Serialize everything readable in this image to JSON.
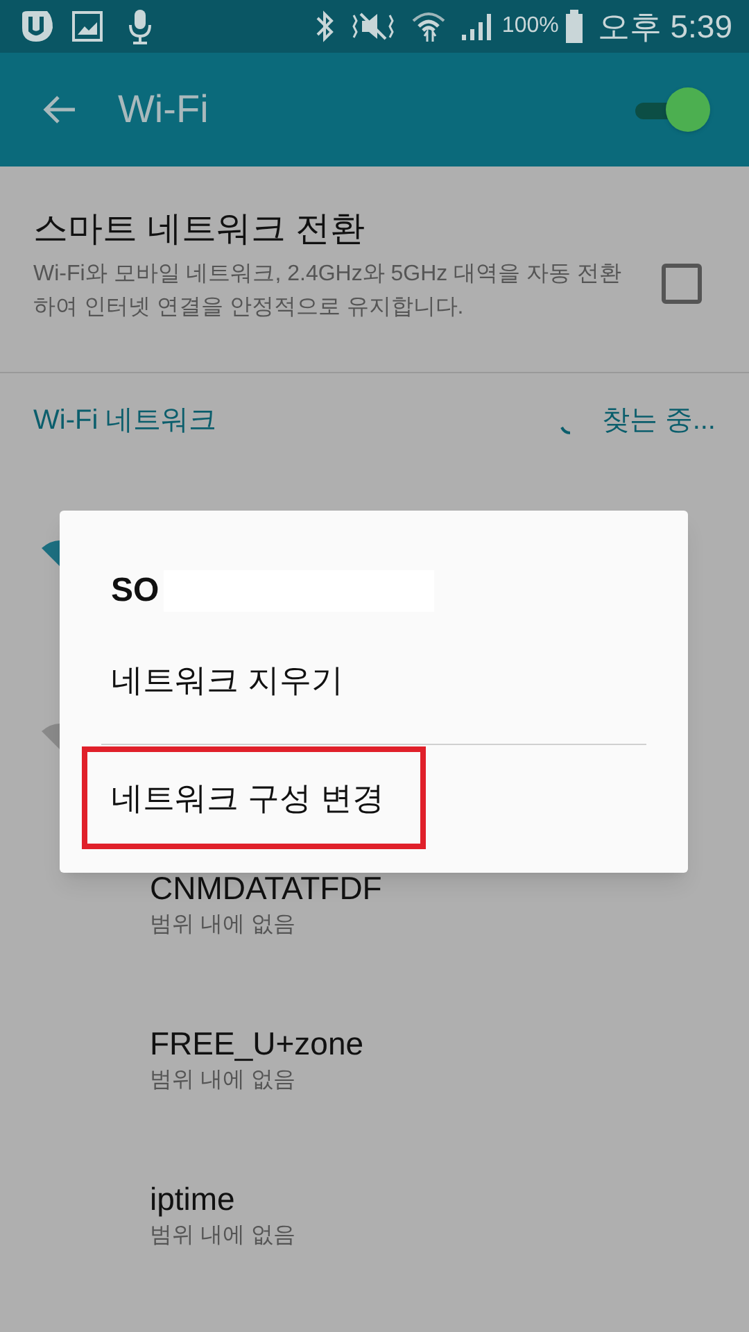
{
  "status_bar": {
    "battery": "100%",
    "time": "오후 5:39"
  },
  "app_bar": {
    "title": "Wi-Fi",
    "wifi_on": true
  },
  "smart_network": {
    "title": "스마트 네트워크 전환",
    "description": "Wi-Fi와 모바일 네트워크, 2.4GHz와 5GHz 대역을 자동 전환하여 인터넷 연결을 안정적으로 유지합니다.",
    "checked": false
  },
  "section": {
    "title": "Wi-Fi 네트워크",
    "status": "찾는 중..."
  },
  "networks": [
    {
      "name": "CNMDATATFDF",
      "status": "범위 내에 없음"
    },
    {
      "name": "FREE_U+zone",
      "status": "범위 내에 없음"
    },
    {
      "name": "iptime",
      "status": "범위 내에 없음"
    }
  ],
  "dialog": {
    "title": "SO",
    "items": [
      {
        "label": "네트워크 지우기",
        "highlighted": false
      },
      {
        "label": "네트워크 구성 변경",
        "highlighted": true
      }
    ]
  }
}
